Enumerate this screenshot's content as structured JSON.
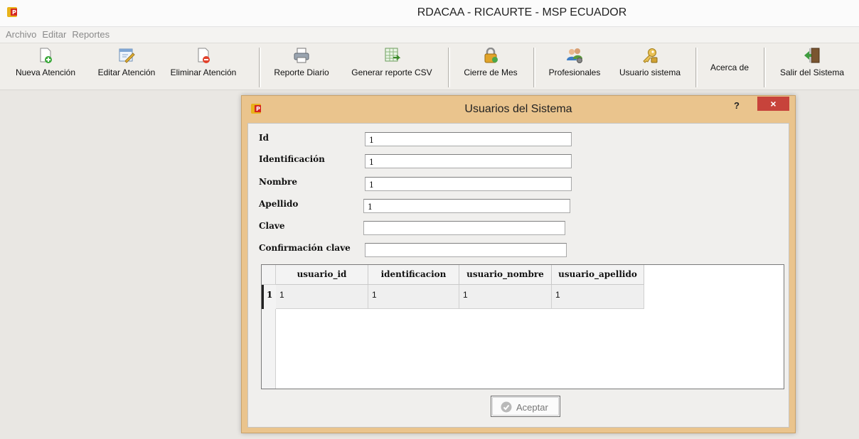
{
  "window": {
    "title": "RDACAA - RICAURTE - MSP ECUADOR"
  },
  "menu": [
    "Archivo",
    "Editar",
    "Reportes"
  ],
  "toolbar": {
    "nueva": "Nueva Atención",
    "editar": "Editar Atención",
    "eliminar": "Eliminar Atención",
    "reporte_diario": "Reporte Diario",
    "csv": "Generar reporte CSV",
    "cierre": "Cierre de Mes",
    "profesionales": "Profesionales",
    "usuario": "Usuario sistema",
    "acerca": "Acerca de",
    "salir": "Salir del Sistema"
  },
  "dialog": {
    "title": "Usuarios del Sistema",
    "help": "?",
    "close": "×",
    "fields": {
      "id": {
        "label": "Id",
        "value": "1"
      },
      "identificacion": {
        "label": "Identificación",
        "value": "1"
      },
      "nombre": {
        "label": "Nombre",
        "value": "1"
      },
      "apellido": {
        "label": "Apellido",
        "value": "1"
      },
      "clave": {
        "label": "Clave",
        "value": ""
      },
      "confirmacion": {
        "label": "Confirmación clave",
        "value": ""
      }
    },
    "table": {
      "columns": [
        "usuario_id",
        "identificacion",
        "usuario_nombre",
        "usuario_apellido"
      ],
      "rows": [
        {
          "num": "1",
          "cells": [
            "1",
            "1",
            "1",
            "1"
          ]
        }
      ]
    },
    "ok": "Aceptar"
  },
  "colors": {
    "dialog_frame": "#eac48d",
    "close_button": "#c7433b"
  }
}
